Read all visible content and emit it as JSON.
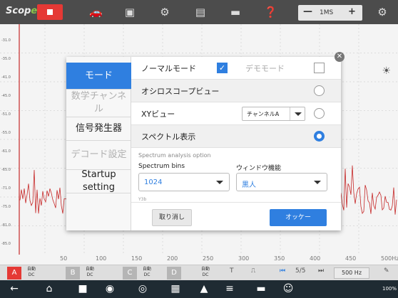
{
  "topbar": {
    "logo_prefix": "Scop",
    "logo_suffix": "e",
    "timebase_value": "1MS",
    "timebase_minus": "—",
    "timebase_plus": "+"
  },
  "scope": {
    "y_ticks": [
      "-31.0",
      "-35.0",
      "-41.0",
      "-45.0",
      "-51.0",
      "-55.0",
      "-61.0",
      "-65.0",
      "-71.0",
      "-75.0",
      "-81.0",
      "-85.0"
    ],
    "x_ticks": [
      "50",
      "100",
      "150",
      "200",
      "250",
      "300",
      "350",
      "400",
      "450",
      "500Hz"
    ],
    "trace_color": "#c62828"
  },
  "channelbar": {
    "channels": [
      {
        "label": "A",
        "auto": "自動",
        "coupling": "DC"
      },
      {
        "label": "B",
        "auto": "自動",
        "coupling": "DC"
      },
      {
        "label": "C",
        "auto": "自動",
        "coupling": "DC"
      },
      {
        "label": "D",
        "auto": "自動",
        "coupling": "DC"
      }
    ],
    "trigger_T": "T",
    "page": "5/5",
    "frequency": "500 Hz"
  },
  "nav": {
    "status": "100%"
  },
  "dialog": {
    "sidebar": [
      {
        "label": "モード",
        "state": "active"
      },
      {
        "label": "数学チャンネル",
        "state": "disabled"
      },
      {
        "label": "信号発生器",
        "state": "normal"
      },
      {
        "label": "デコード設定",
        "state": "disabled"
      },
      {
        "label": "Startup setting",
        "state": "normal"
      }
    ],
    "normal_mode": "ノーマルモード",
    "demo_mode": "デモモード",
    "oscilloscope_view": "オシロスコープビュー",
    "xy_view": "XYビュー",
    "xy_channel": "チャンネルA",
    "spectrum_view": "スペクトル表示",
    "spectrum_option_title": "Spectrum analysis option",
    "spectrum_bins_label": "Spectrum bins",
    "spectrum_bins_value": "1024",
    "window_func_label": "ウィンドウ機能",
    "window_func_value": "黒人",
    "partial_label": "Y3b",
    "cancel": "取り消し",
    "ok": "オッケー",
    "selected_view": "spectrum"
  },
  "colors": {
    "accent": "#2f7fe0",
    "stop": "#e53935"
  }
}
